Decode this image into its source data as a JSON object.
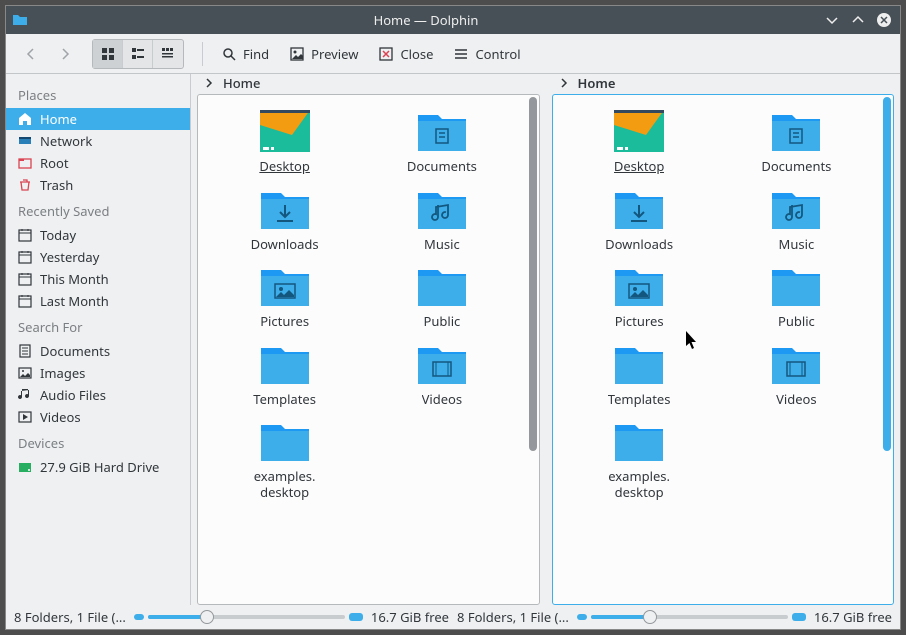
{
  "window": {
    "title": "Home — Dolphin"
  },
  "toolbar": {
    "find": "Find",
    "preview": "Preview",
    "close": "Close",
    "control": "Control"
  },
  "sidebar": {
    "sections": [
      {
        "title": "Places",
        "items": [
          {
            "label": "Home",
            "icon": "home",
            "active": true
          },
          {
            "label": "Network",
            "icon": "network"
          },
          {
            "label": "Root",
            "icon": "root"
          },
          {
            "label": "Trash",
            "icon": "trash"
          }
        ]
      },
      {
        "title": "Recently Saved",
        "items": [
          {
            "label": "Today",
            "icon": "calendar"
          },
          {
            "label": "Yesterday",
            "icon": "calendar"
          },
          {
            "label": "This Month",
            "icon": "calendar"
          },
          {
            "label": "Last Month",
            "icon": "calendar"
          }
        ]
      },
      {
        "title": "Search For",
        "items": [
          {
            "label": "Documents",
            "icon": "doc"
          },
          {
            "label": "Images",
            "icon": "image"
          },
          {
            "label": "Audio Files",
            "icon": "audio"
          },
          {
            "label": "Videos",
            "icon": "video"
          }
        ]
      },
      {
        "title": "Devices",
        "items": [
          {
            "label": "27.9 GiB Hard Drive",
            "icon": "drive"
          }
        ]
      }
    ]
  },
  "panes": [
    {
      "breadcrumb": "Home",
      "active": false,
      "selected": "Desktop",
      "items": [
        {
          "label": "Desktop",
          "icon": "desktop"
        },
        {
          "label": "Documents",
          "icon": "folder-doc"
        },
        {
          "label": "Downloads",
          "icon": "folder-down"
        },
        {
          "label": "Music",
          "icon": "folder-music"
        },
        {
          "label": "Pictures",
          "icon": "folder-pic"
        },
        {
          "label": "Public",
          "icon": "folder"
        },
        {
          "label": "Templates",
          "icon": "folder"
        },
        {
          "label": "Videos",
          "icon": "folder-vid"
        },
        {
          "label": "examples.desktop",
          "icon": "folder"
        }
      ]
    },
    {
      "breadcrumb": "Home",
      "active": true,
      "selected": "Desktop",
      "items": [
        {
          "label": "Desktop",
          "icon": "desktop"
        },
        {
          "label": "Documents",
          "icon": "folder-doc"
        },
        {
          "label": "Downloads",
          "icon": "folder-down"
        },
        {
          "label": "Music",
          "icon": "folder-music"
        },
        {
          "label": "Pictures",
          "icon": "folder-pic"
        },
        {
          "label": "Public",
          "icon": "folder"
        },
        {
          "label": "Templates",
          "icon": "folder"
        },
        {
          "label": "Videos",
          "icon": "folder-vid"
        },
        {
          "label": "examples.desktop",
          "icon": "folder"
        }
      ]
    }
  ],
  "status": {
    "left": {
      "text": "8 Folders, 1 File (...",
      "free": "16.7 GiB free"
    },
    "right": {
      "text": "8 Folders, 1 File (...",
      "free": "16.7 GiB free"
    }
  }
}
